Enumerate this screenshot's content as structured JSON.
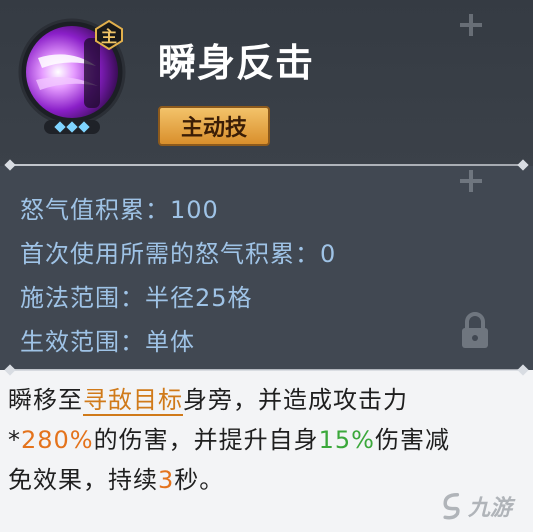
{
  "skill": {
    "name": "瞬身反击",
    "badge": "主",
    "type_tag": "主动技",
    "level_gems": 3
  },
  "stats": [
    {
      "label": "怒气值积累：",
      "value": "100"
    },
    {
      "label": "首次使用所需的怒气积累：",
      "value": "0"
    },
    {
      "label": "施法范围：",
      "value": "半径25格"
    },
    {
      "label": "生效范围：",
      "value": "单体"
    }
  ],
  "description": {
    "line1_a": "瞬移至",
    "line1_target": "寻敌目标",
    "line1_b": "身旁，并造成攻击力",
    "line2_a": "*",
    "line2_pct1": "280%",
    "line2_b": "的伤害，并提升自身",
    "line2_pct2": "15%",
    "line2_c": "伤害减",
    "line3_a": "免效果，持续",
    "line3_num": "3",
    "line3_b": "秒。"
  },
  "watermark": {
    "text": "九游"
  },
  "colors": {
    "stat_text": "#9fc3e6",
    "highlight_orange": "#e4731c",
    "highlight_green": "#3ba83b",
    "tag_gold": "#e8aa4a",
    "skill_purple": "#c43cff"
  }
}
